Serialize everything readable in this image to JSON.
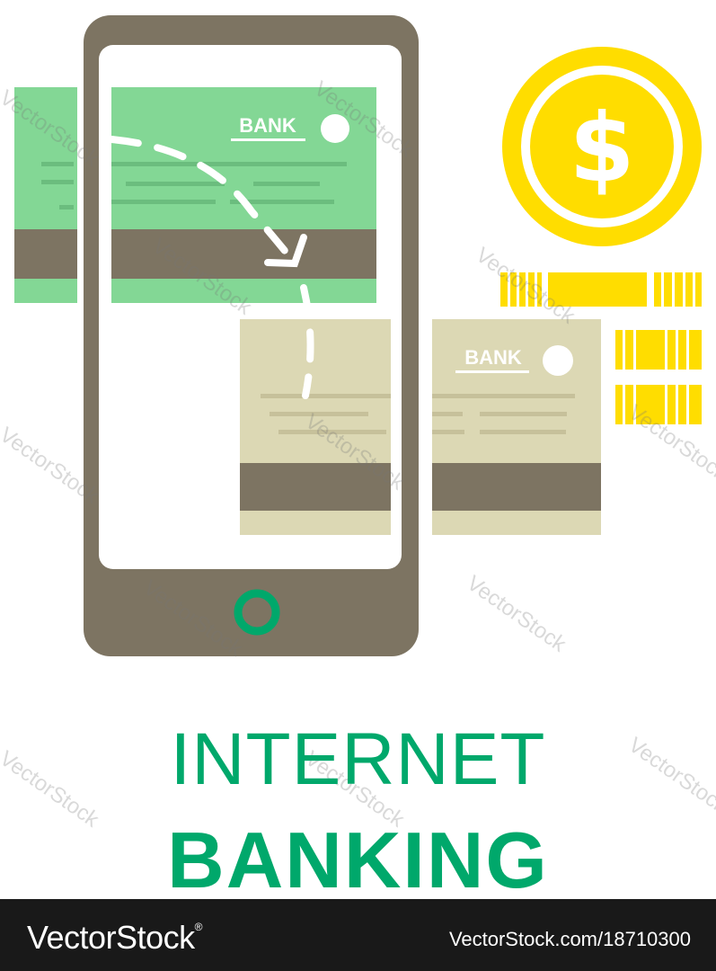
{
  "illustration": {
    "bank_label": "BANK",
    "colors": {
      "phone": "#7d7462",
      "green_card": "#83d795",
      "beige_card": "#dcd8b4",
      "stripe": "#7d7462",
      "coin": "#ffdd00",
      "accent": "#00a86b"
    }
  },
  "title": {
    "line1": "INTERNET",
    "line2": "BANKING"
  },
  "footer": {
    "brand": "VectorStock",
    "registered": "®",
    "image_id": "VectorStock.com/18710300"
  },
  "watermark": "VectorStock"
}
